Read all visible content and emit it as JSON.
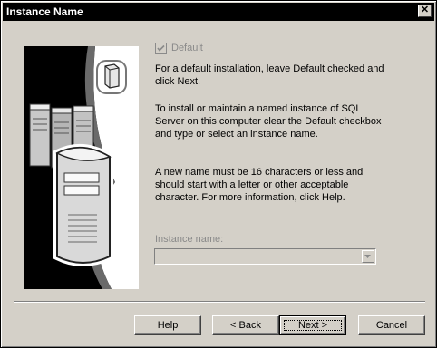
{
  "window": {
    "title": "Instance Name",
    "close_glyph": "✕"
  },
  "default_checkbox": {
    "label": "Default",
    "checked": true,
    "enabled": false
  },
  "paragraphs": [
    "For a default installation, leave Default checked and click Next.",
    "To install or maintain a named instance of SQL Server on this computer clear the Default checkbox and type or select an instance name.",
    "A new name must be 16 characters or less and should start with a letter or other acceptable character. For more information, click Help."
  ],
  "instance_name": {
    "label": "Instance name:",
    "value": "",
    "enabled": false
  },
  "buttons": {
    "help": "Help",
    "back": "< Back",
    "next": "Next >",
    "cancel": "Cancel"
  },
  "icons": {
    "art": "server-illustration",
    "combo": "chevron-down-icon",
    "check": "check-icon"
  }
}
